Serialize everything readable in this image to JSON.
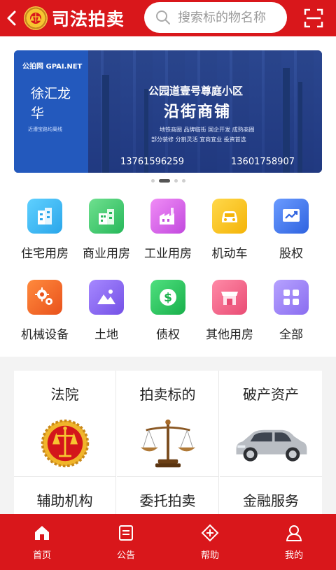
{
  "header": {
    "brand": "司法拍卖",
    "search_placeholder": "搜索标的物名称"
  },
  "banner": {
    "logo_text": "公拍网 GPAI.NET",
    "city": "徐汇龙华",
    "tagline": "近漕宝路均离线",
    "title_line1": "公园道壹号尊庭小区",
    "title_line2": "沿街商铺",
    "sub_line1": "地铁商圈 品牌临街   国企开发 成熟商圈",
    "sub_line2": "部分装修 分割灵活   宜商宜业 投资首选",
    "phone1": "13761596259",
    "phone2": "13601758907",
    "dots": 4,
    "active_dot": 1
  },
  "categories": [
    {
      "label": "住宅用房",
      "icon": "residential-icon",
      "color": "#37b6f0"
    },
    {
      "label": "商业用房",
      "icon": "commercial-icon",
      "color": "#37c86b"
    },
    {
      "label": "工业用房",
      "icon": "industrial-icon",
      "color": "#d865e6"
    },
    {
      "label": "机动车",
      "icon": "car-icon",
      "color": "#f6c21c"
    },
    {
      "label": "股权",
      "icon": "chart-icon",
      "color": "#3f74ea"
    },
    {
      "label": "机械设备",
      "icon": "gears-icon",
      "color": "#f26a2b"
    },
    {
      "label": "土地",
      "icon": "land-icon",
      "color": "#8a6cf0"
    },
    {
      "label": "债权",
      "icon": "dollar-icon",
      "color": "#2dc35e"
    },
    {
      "label": "其他用房",
      "icon": "shop-icon",
      "color": "#f06d8d"
    },
    {
      "label": "全部",
      "icon": "grid-icon",
      "color": "#9b82f4"
    }
  ],
  "services": [
    {
      "label": "法院",
      "image": "court-emblem"
    },
    {
      "label": "拍卖标的",
      "image": "scales"
    },
    {
      "label": "破产资产",
      "image": "car-photo"
    },
    {
      "label": "辅助机构"
    },
    {
      "label": "委托拍卖"
    },
    {
      "label": "金融服务"
    }
  ],
  "tabbar": [
    {
      "label": "首页",
      "icon": "home-icon"
    },
    {
      "label": "公告",
      "icon": "notice-icon"
    },
    {
      "label": "帮助",
      "icon": "help-icon"
    },
    {
      "label": "我的",
      "icon": "user-icon"
    }
  ],
  "colors": {
    "brand_red": "#d9171b",
    "banner_blue": "#2c4fa3"
  }
}
